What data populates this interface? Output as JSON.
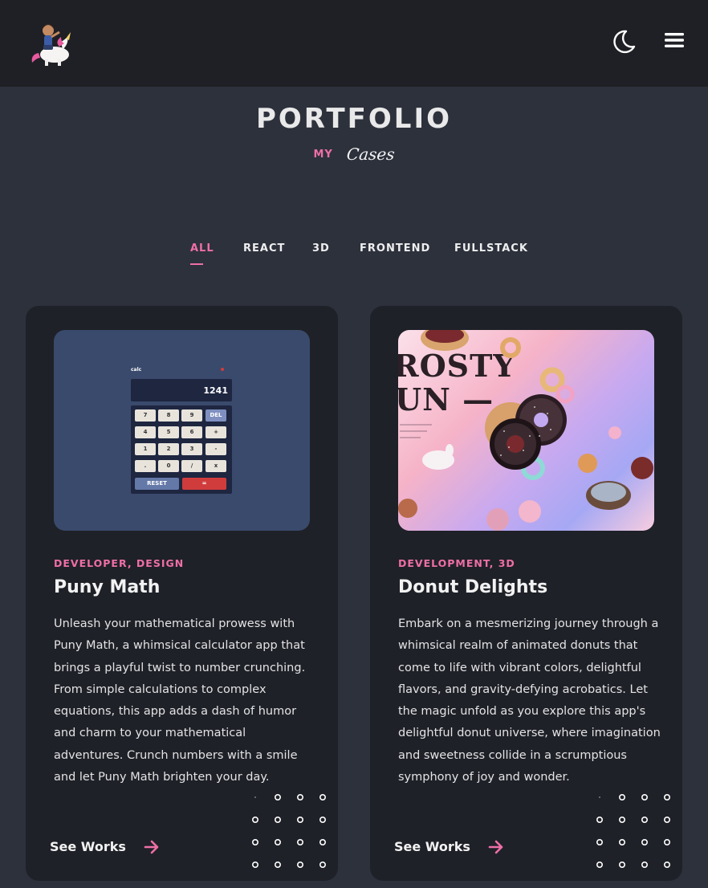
{
  "header": {
    "logo_name": "unicorn-rider-logo",
    "theme_icon": "moon-icon",
    "menu_icon": "hamburger-menu-icon"
  },
  "section": {
    "title": "PORTFOLIO",
    "sub_small": "MY",
    "sub_script": "Cases"
  },
  "filters": [
    {
      "label": "ALL",
      "active": true
    },
    {
      "label": "REACT",
      "active": false
    },
    {
      "label": "3D",
      "active": false
    },
    {
      "label": "FRONTEND",
      "active": false
    },
    {
      "label": "FULLSTACK",
      "active": false
    }
  ],
  "cards": [
    {
      "category": "DEVELOPER, DESIGN",
      "title": "Puny Math",
      "description": "Unleash your mathematical prowess with Puny Math, a whimsical calculator app that brings a playful twist to number crunching. From simple calculations to complex equations, this app adds a dash of humor and charm to your mathematical adventures. Crunch numbers with a smile and let Puny Math brighten your day.",
      "link_label": "See Works",
      "image": {
        "app_label": "calc",
        "display": "1241",
        "keys": [
          "7",
          "8",
          "9",
          "DEL",
          "4",
          "5",
          "6",
          "+",
          "1",
          "2",
          "3",
          "-",
          ".",
          "0",
          "/",
          "x"
        ],
        "reset": "RESET",
        "equals": "="
      }
    },
    {
      "category": "DEVELOPMENT, 3D",
      "title": "Donut Delights",
      "description": "Embark on a mesmerizing journey through a whimsical realm of animated donuts that come to life with vibrant colors, delightful flavors, and gravity-defying acrobatics. Let the magic unfold as you explore this app's delightful donut universe, where imagination and sweetness collide in a scrumptious symphony of joy and wonder.",
      "link_label": "See Works",
      "image": {
        "line1": "ROSTY",
        "line2": "UN —"
      }
    }
  ],
  "colors": {
    "accent": "#ee6fa6",
    "page_bg": "#2d313c",
    "header_bg": "#1f2025",
    "card_bg": "#1f2128"
  }
}
